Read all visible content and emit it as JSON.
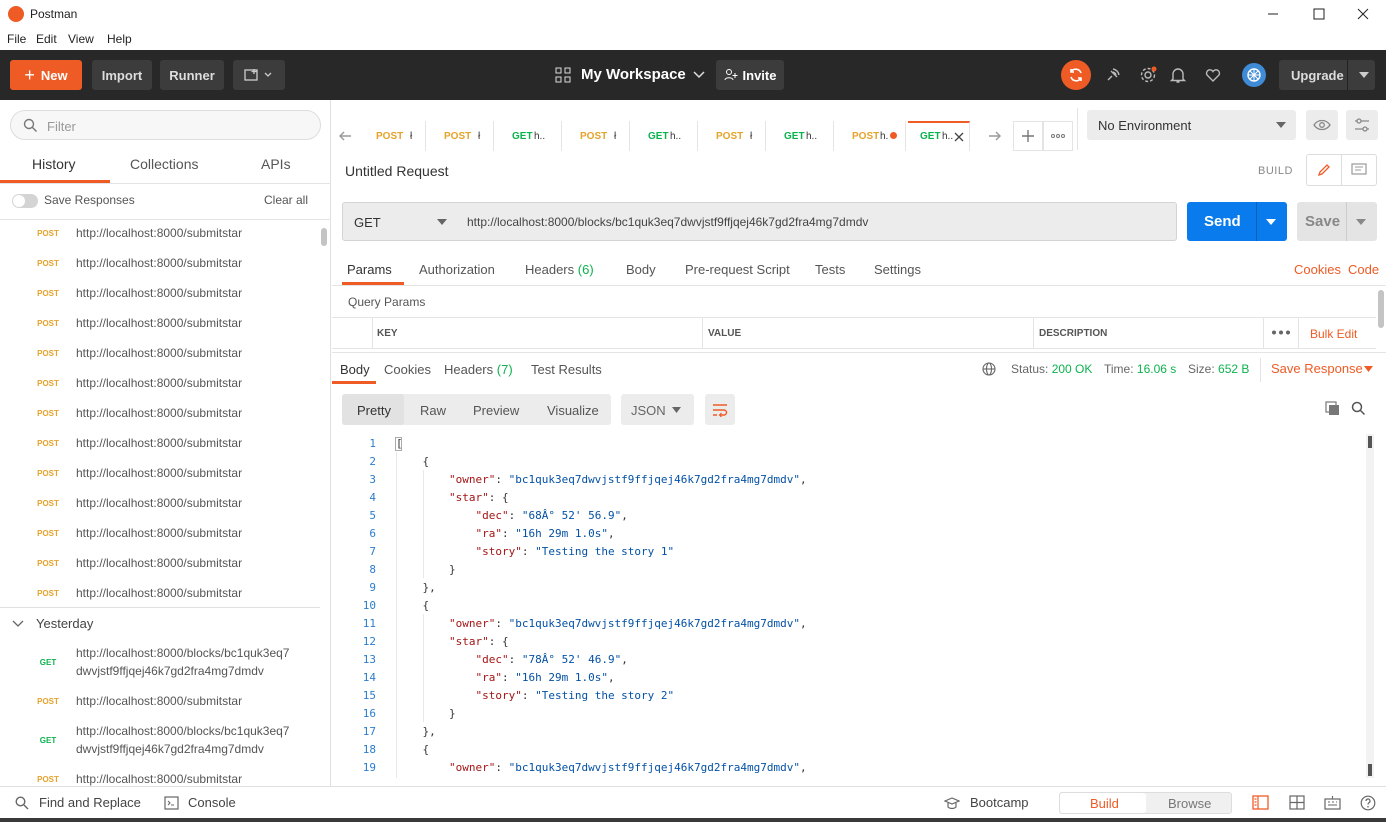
{
  "window": {
    "title": "Postman"
  },
  "menu": [
    "File",
    "Edit",
    "View",
    "Help"
  ],
  "header": {
    "new_label": "New",
    "import_label": "Import",
    "runner_label": "Runner",
    "workspace_label": "My Workspace",
    "invite_label": "Invite",
    "upgrade_label": "Upgrade"
  },
  "sidebar": {
    "filter_placeholder": "Filter",
    "tabs": [
      "History",
      "Collections",
      "APIs"
    ],
    "save_responses_label": "Save Responses",
    "clear_all_label": "Clear all",
    "items": [
      {
        "method": "POST",
        "url": "http://localhost:8000/submitstar"
      },
      {
        "method": "POST",
        "url": "http://localhost:8000/submitstar"
      },
      {
        "method": "POST",
        "url": "http://localhost:8000/submitstar"
      },
      {
        "method": "POST",
        "url": "http://localhost:8000/submitstar"
      },
      {
        "method": "POST",
        "url": "http://localhost:8000/submitstar"
      },
      {
        "method": "POST",
        "url": "http://localhost:8000/submitstar"
      },
      {
        "method": "POST",
        "url": "http://localhost:8000/submitstar"
      },
      {
        "method": "POST",
        "url": "http://localhost:8000/submitstar"
      },
      {
        "method": "POST",
        "url": "http://localhost:8000/submitstar"
      },
      {
        "method": "POST",
        "url": "http://localhost:8000/submitstar"
      },
      {
        "method": "POST",
        "url": "http://localhost:8000/submitstar"
      },
      {
        "method": "POST",
        "url": "http://localhost:8000/submitstar"
      },
      {
        "method": "POST",
        "url": "http://localhost:8000/submitstar"
      }
    ],
    "yesterday_label": "Yesterday",
    "yesterday_items": [
      {
        "method": "GET",
        "url_line1": "http://localhost:8000/blocks/bc1quk3eq7",
        "url_line2": "dwvjstf9ffjqej46k7gd2fra4mg7dmdv"
      },
      {
        "method": "POST",
        "url_line1": "http://localhost:8000/submitstar",
        "url_line2": ""
      },
      {
        "method": "GET",
        "url_line1": "http://localhost:8000/blocks/bc1quk3eq7",
        "url_line2": "dwvjstf9ffjqej46k7gd2fra4mg7dmdv"
      },
      {
        "method": "POST",
        "url_line1": "http://localhost:8000/submitstar",
        "url_line2": ""
      }
    ]
  },
  "tabs": [
    {
      "method": "POST",
      "name": "ł"
    },
    {
      "method": "POST",
      "name": "ł"
    },
    {
      "method": "GET",
      "name": "h.."
    },
    {
      "method": "POST",
      "name": "ł"
    },
    {
      "method": "GET",
      "name": "h.."
    },
    {
      "method": "POST",
      "name": "ł"
    },
    {
      "method": "GET",
      "name": "h.."
    },
    {
      "method": "POST",
      "name": "h."
    },
    {
      "method": "GET",
      "name": "h.."
    }
  ],
  "environment": {
    "selected": "No Environment"
  },
  "request": {
    "title": "Untitled Request",
    "build_label": "BUILD",
    "method": "GET",
    "url": "http://localhost:8000/blocks/bc1quk3eq7dwvjstf9ffjqej46k7gd2fra4mg7dmdv",
    "send_label": "Send",
    "save_label": "Save",
    "tabs": {
      "params": "Params",
      "authorization": "Authorization",
      "headers": "Headers",
      "headers_count": "(6)",
      "body": "Body",
      "prerequest": "Pre-request Script",
      "tests": "Tests",
      "settings": "Settings"
    },
    "cookies_link": "Cookies",
    "code_link": "Code",
    "query_params_label": "Query Params",
    "table_headers": [
      "KEY",
      "VALUE",
      "DESCRIPTION"
    ],
    "bulk_edit_label": "Bulk Edit"
  },
  "response": {
    "tabs": {
      "body": "Body",
      "cookies": "Cookies",
      "headers": "Headers",
      "headers_count": "(7)",
      "test_results": "Test Results"
    },
    "status_label": "Status:",
    "status_value": "200 OK",
    "time_label": "Time:",
    "time_value": "16.06 s",
    "size_label": "Size:",
    "size_value": "652 B",
    "save_response_label": "Save Response",
    "view_modes": [
      "Pretty",
      "Raw",
      "Preview",
      "Visualize"
    ],
    "format": "JSON",
    "lines": [
      "[",
      "    {",
      "        \"owner\": \"bc1quk3eq7dwvjstf9ffjqej46k7gd2fra4mg7dmdv\",",
      "        \"star\": {",
      "            \"dec\": \"68Â° 52' 56.9\",",
      "            \"ra\": \"16h 29m 1.0s\",",
      "            \"story\": \"Testing the story 1\"",
      "        }",
      "    },",
      "    {",
      "        \"owner\": \"bc1quk3eq7dwvjstf9ffjqej46k7gd2fra4mg7dmdv\",",
      "        \"star\": {",
      "            \"dec\": \"78Â° 52' 46.9\",",
      "            \"ra\": \"16h 29m 1.0s\",",
      "            \"story\": \"Testing the story 2\"",
      "        }",
      "    },",
      "    {",
      "        \"owner\": \"bc1quk3eq7dwvjstf9ffjqej46k7gd2fra4mg7dmdv\","
    ]
  },
  "footer": {
    "find_replace_label": "Find and Replace",
    "console_label": "Console",
    "bootcamp_label": "Bootcamp",
    "build_label": "Build",
    "browse_label": "Browse"
  },
  "colors": {
    "accent": "#ef5b25",
    "post": "#e6a22b",
    "get": "#0cb34d",
    "send": "#097bed",
    "header_bg": "#282828"
  }
}
